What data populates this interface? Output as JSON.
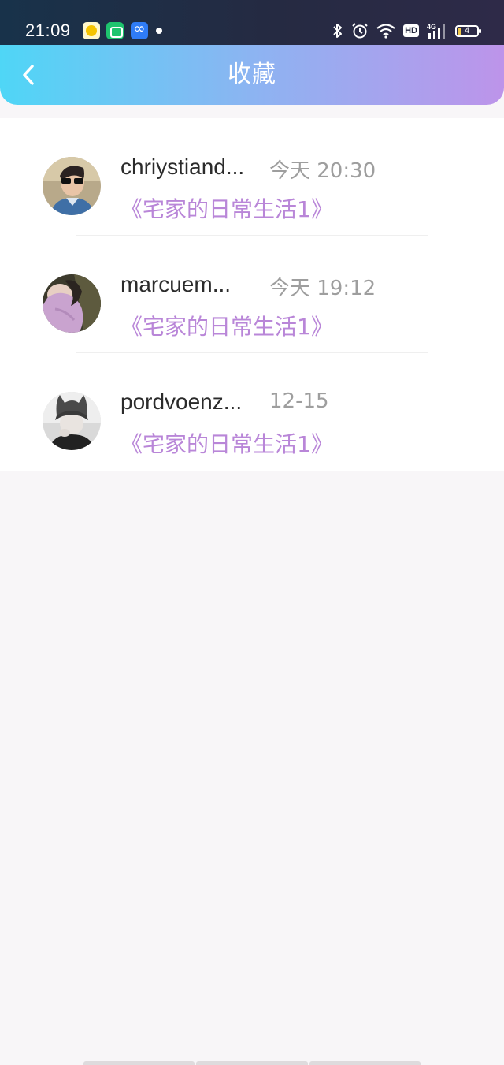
{
  "status_bar": {
    "time": "21:09",
    "hd_label": "HD",
    "network_label": "4G",
    "battery_level": "4",
    "icons": [
      "app-notification-icon",
      "app-notification-icon",
      "app-notification-icon",
      "notification-dot",
      "bluetooth-icon",
      "alarm-icon",
      "wifi-icon",
      "hd-icon",
      "signal-icon",
      "battery-icon"
    ]
  },
  "header": {
    "title": "收藏",
    "back_icon": "chevron-left-icon",
    "gradient": [
      "#4fd6f6",
      "#bd94ea"
    ]
  },
  "favorites": [
    {
      "username": "chriystiand...",
      "time": "今天 20:30",
      "work_title": "《宅家的日常生活1》"
    },
    {
      "username": "marcuem...",
      "time": "今天 19:12",
      "work_title": "《宅家的日常生活1》"
    },
    {
      "username": "pordvoenz...",
      "time": "12-15",
      "work_title": "《宅家的日常生活1》"
    }
  ],
  "colors": {
    "accent_text": "#b986d8",
    "time_text": "#9e9e9e",
    "page_background": "#f8f6f8"
  }
}
